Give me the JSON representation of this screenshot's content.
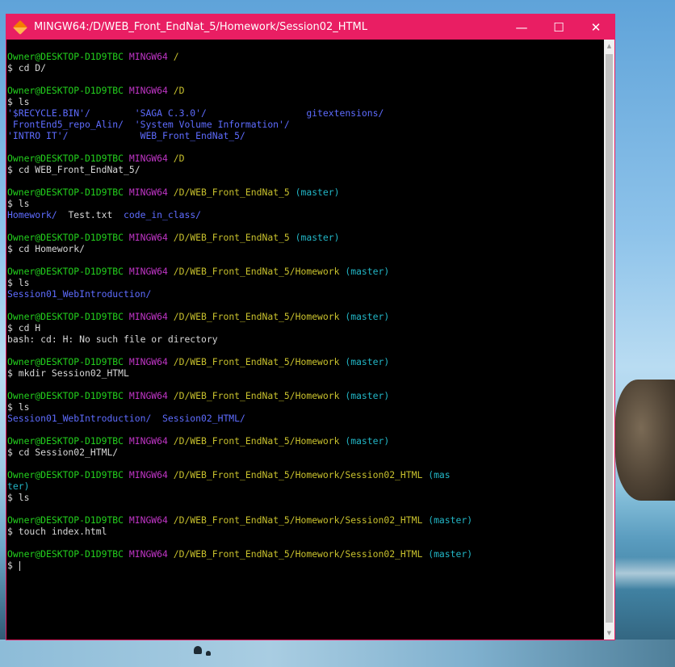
{
  "window": {
    "title": "MINGW64:/D/WEB_Front_EndNat_5/Homework/Session02_HTML",
    "controls": {
      "minimize": "—",
      "maximize": "☐",
      "close": "✕"
    },
    "accent_color": "#e91e63",
    "icon": "git-bash-diamond-icon"
  },
  "terminal": {
    "lines": [
      {
        "segs": [
          {
            "t": "Owner@DESKTOP-D1D9TBC ",
            "c": "green"
          },
          {
            "t": "MINGW64 ",
            "c": "magenta"
          },
          {
            "t": "/",
            "c": "yellow"
          }
        ]
      },
      {
        "segs": [
          {
            "t": "$ cd D/",
            "c": "white"
          }
        ]
      },
      {
        "segs": []
      },
      {
        "segs": [
          {
            "t": "Owner@DESKTOP-D1D9TBC ",
            "c": "green"
          },
          {
            "t": "MINGW64 ",
            "c": "magenta"
          },
          {
            "t": "/D",
            "c": "yellow"
          }
        ]
      },
      {
        "segs": [
          {
            "t": "$ ls",
            "c": "white"
          }
        ]
      },
      {
        "segs": [
          {
            "t": "'$RECYCLE.BIN'/        'SAGA C.3.0'/                  gitextensions/",
            "c": "blue"
          }
        ]
      },
      {
        "segs": [
          {
            "t": " FrontEnd5_repo_Alin/  'System Volume Information'/",
            "c": "blue"
          }
        ]
      },
      {
        "segs": [
          {
            "t": "'INTRO IT'/             WEB_Front_EndNat_5/",
            "c": "blue"
          }
        ]
      },
      {
        "segs": []
      },
      {
        "segs": [
          {
            "t": "Owner@DESKTOP-D1D9TBC ",
            "c": "green"
          },
          {
            "t": "MINGW64 ",
            "c": "magenta"
          },
          {
            "t": "/D",
            "c": "yellow"
          }
        ]
      },
      {
        "segs": [
          {
            "t": "$ cd WEB_Front_EndNat_5/",
            "c": "white"
          }
        ]
      },
      {
        "segs": []
      },
      {
        "segs": [
          {
            "t": "Owner@DESKTOP-D1D9TBC ",
            "c": "green"
          },
          {
            "t": "MINGW64 ",
            "c": "magenta"
          },
          {
            "t": "/D/WEB_Front_EndNat_5 ",
            "c": "yellow"
          },
          {
            "t": "(master)",
            "c": "cyan"
          }
        ]
      },
      {
        "segs": [
          {
            "t": "$ ls",
            "c": "white"
          }
        ]
      },
      {
        "segs": [
          {
            "t": "Homework/",
            "c": "blue"
          },
          {
            "t": "  Test.txt  ",
            "c": "white"
          },
          {
            "t": "code_in_class/",
            "c": "blue"
          }
        ]
      },
      {
        "segs": []
      },
      {
        "segs": [
          {
            "t": "Owner@DESKTOP-D1D9TBC ",
            "c": "green"
          },
          {
            "t": "MINGW64 ",
            "c": "magenta"
          },
          {
            "t": "/D/WEB_Front_EndNat_5 ",
            "c": "yellow"
          },
          {
            "t": "(master)",
            "c": "cyan"
          }
        ]
      },
      {
        "segs": [
          {
            "t": "$ cd Homework/",
            "c": "white"
          }
        ]
      },
      {
        "segs": []
      },
      {
        "segs": [
          {
            "t": "Owner@DESKTOP-D1D9TBC ",
            "c": "green"
          },
          {
            "t": "MINGW64 ",
            "c": "magenta"
          },
          {
            "t": "/D/WEB_Front_EndNat_5/Homework ",
            "c": "yellow"
          },
          {
            "t": "(master)",
            "c": "cyan"
          }
        ]
      },
      {
        "segs": [
          {
            "t": "$ ls",
            "c": "white"
          }
        ]
      },
      {
        "segs": [
          {
            "t": "Session01_WebIntroduction/",
            "c": "blue"
          }
        ]
      },
      {
        "segs": []
      },
      {
        "segs": [
          {
            "t": "Owner@DESKTOP-D1D9TBC ",
            "c": "green"
          },
          {
            "t": "MINGW64 ",
            "c": "magenta"
          },
          {
            "t": "/D/WEB_Front_EndNat_5/Homework ",
            "c": "yellow"
          },
          {
            "t": "(master)",
            "c": "cyan"
          }
        ]
      },
      {
        "segs": [
          {
            "t": "$ cd H",
            "c": "white"
          }
        ]
      },
      {
        "segs": [
          {
            "t": "bash: cd: H: No such file or directory",
            "c": "white"
          }
        ]
      },
      {
        "segs": []
      },
      {
        "segs": [
          {
            "t": "Owner@DESKTOP-D1D9TBC ",
            "c": "green"
          },
          {
            "t": "MINGW64 ",
            "c": "magenta"
          },
          {
            "t": "/D/WEB_Front_EndNat_5/Homework ",
            "c": "yellow"
          },
          {
            "t": "(master)",
            "c": "cyan"
          }
        ]
      },
      {
        "segs": [
          {
            "t": "$ mkdir Session02_HTML",
            "c": "white"
          }
        ]
      },
      {
        "segs": []
      },
      {
        "segs": [
          {
            "t": "Owner@DESKTOP-D1D9TBC ",
            "c": "green"
          },
          {
            "t": "MINGW64 ",
            "c": "magenta"
          },
          {
            "t": "/D/WEB_Front_EndNat_5/Homework ",
            "c": "yellow"
          },
          {
            "t": "(master)",
            "c": "cyan"
          }
        ]
      },
      {
        "segs": [
          {
            "t": "$ ls",
            "c": "white"
          }
        ]
      },
      {
        "segs": [
          {
            "t": "Session01_WebIntroduction/  Session02_HTML/",
            "c": "blue"
          }
        ]
      },
      {
        "segs": []
      },
      {
        "segs": [
          {
            "t": "Owner@DESKTOP-D1D9TBC ",
            "c": "green"
          },
          {
            "t": "MINGW64 ",
            "c": "magenta"
          },
          {
            "t": "/D/WEB_Front_EndNat_5/Homework ",
            "c": "yellow"
          },
          {
            "t": "(master)",
            "c": "cyan"
          }
        ]
      },
      {
        "segs": [
          {
            "t": "$ cd Session02_HTML/",
            "c": "white"
          }
        ]
      },
      {
        "segs": []
      },
      {
        "segs": [
          {
            "t": "Owner@DESKTOP-D1D9TBC ",
            "c": "green"
          },
          {
            "t": "MINGW64 ",
            "c": "magenta"
          },
          {
            "t": "/D/WEB_Front_EndNat_5/Homework/Session02_HTML ",
            "c": "yellow"
          },
          {
            "t": "(mas",
            "c": "cyan"
          }
        ]
      },
      {
        "segs": [
          {
            "t": "ter)",
            "c": "cyan"
          }
        ]
      },
      {
        "segs": [
          {
            "t": "$ ls",
            "c": "white"
          }
        ]
      },
      {
        "segs": []
      },
      {
        "segs": [
          {
            "t": "Owner@DESKTOP-D1D9TBC ",
            "c": "green"
          },
          {
            "t": "MINGW64 ",
            "c": "magenta"
          },
          {
            "t": "/D/WEB_Front_EndNat_5/Homework/Session02_HTML ",
            "c": "yellow"
          },
          {
            "t": "(master)",
            "c": "cyan"
          }
        ]
      },
      {
        "segs": [
          {
            "t": "$ touch index.html",
            "c": "white"
          }
        ]
      },
      {
        "segs": []
      },
      {
        "segs": [
          {
            "t": "Owner@DESKTOP-D1D9TBC ",
            "c": "green"
          },
          {
            "t": "MINGW64 ",
            "c": "magenta"
          },
          {
            "t": "/D/WEB_Front_EndNat_5/Homework/Session02_HTML ",
            "c": "yellow"
          },
          {
            "t": "(master)",
            "c": "cyan"
          }
        ]
      },
      {
        "segs": [
          {
            "t": "$ ",
            "c": "white"
          }
        ],
        "cursor": true
      }
    ]
  }
}
